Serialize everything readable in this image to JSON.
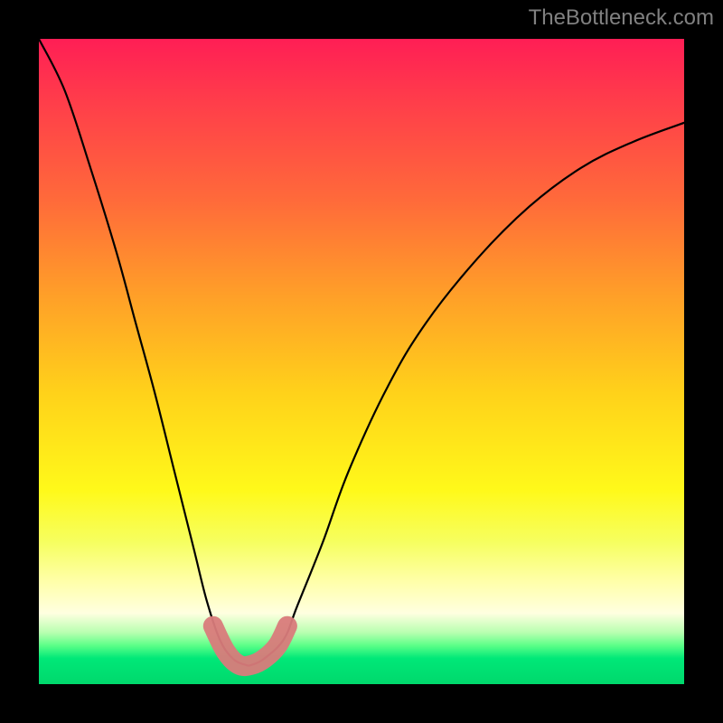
{
  "attribution": "TheBottleneck.com",
  "chart_data": {
    "type": "line",
    "title": "",
    "xlabel": "",
    "ylabel": "",
    "xlim": [
      0,
      100
    ],
    "ylim": [
      0,
      100
    ],
    "series": [
      {
        "name": "bottleneck-curve",
        "x": [
          0,
          4,
          8,
          12,
          15,
          18,
          21,
          24,
          26,
          28,
          30,
          32,
          33,
          35,
          38,
          40,
          44,
          48,
          54,
          60,
          68,
          76,
          84,
          92,
          100
        ],
        "values": [
          100,
          92,
          80,
          67,
          56,
          45,
          33,
          21,
          13,
          7,
          4,
          3,
          3,
          4,
          7,
          12,
          22,
          33,
          46,
          56,
          66,
          74,
          80,
          84,
          87
        ]
      },
      {
        "name": "highlight-band",
        "x": [
          27,
          29,
          31,
          33,
          35,
          37,
          38.5
        ],
        "values": [
          9,
          5,
          3,
          3,
          4,
          6,
          9
        ]
      }
    ],
    "grid": false,
    "legend": false
  }
}
